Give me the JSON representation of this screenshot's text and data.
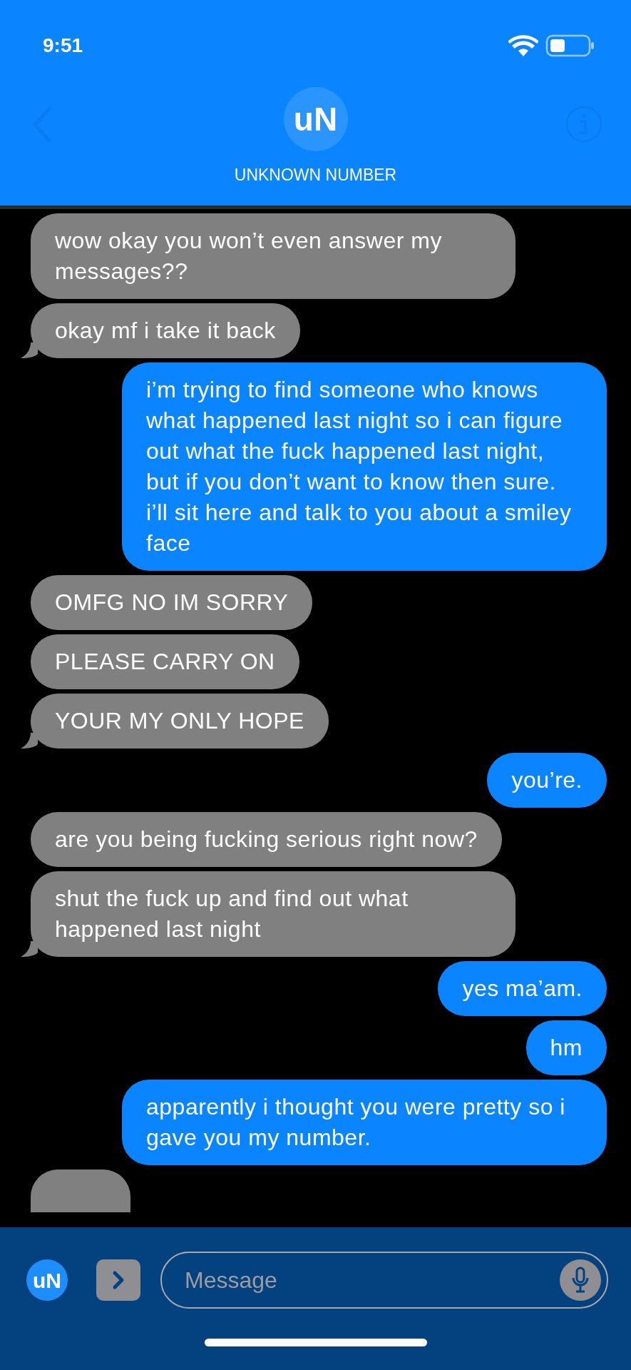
{
  "status_bar": {
    "time": "9:51"
  },
  "header": {
    "avatar_initials": "uN",
    "contact_name": "UNKNOWN NUMBER"
  },
  "messages": [
    {
      "kind": "received",
      "text": "wow okay you won’t even answer my messages??",
      "tail": false
    },
    {
      "kind": "received",
      "text": "okay mf i take it back",
      "tail": true
    },
    {
      "kind": "sent",
      "text": "i’m trying to find someone who knows what happened last night so i can figure out what the fuck happened last night, but if you don’t want to know then sure. i’ll sit here and talk to you about a smiley face",
      "tail": false
    },
    {
      "kind": "received",
      "text": "OMFG NO IM SORRY",
      "tail": false
    },
    {
      "kind": "received",
      "text": "PLEASE CARRY ON",
      "tail": false
    },
    {
      "kind": "received",
      "text": "YOUR MY ONLY HOPE",
      "tail": true
    },
    {
      "kind": "sent",
      "text": "you’re.",
      "tail": false
    },
    {
      "kind": "received",
      "text": "are you being fucking serious right now?",
      "tail": false
    },
    {
      "kind": "received",
      "text": "shut the fuck up and find out what happened last night",
      "tail": true
    },
    {
      "kind": "sent",
      "text": "yes ma’am.",
      "tail": false
    },
    {
      "kind": "sent",
      "text": "hm",
      "tail": false
    },
    {
      "kind": "sent",
      "text": "apparently i thought you were pretty so i gave you my number.",
      "tail": false
    }
  ],
  "composer": {
    "avatar_initials": "uN",
    "placeholder": "Message"
  }
}
